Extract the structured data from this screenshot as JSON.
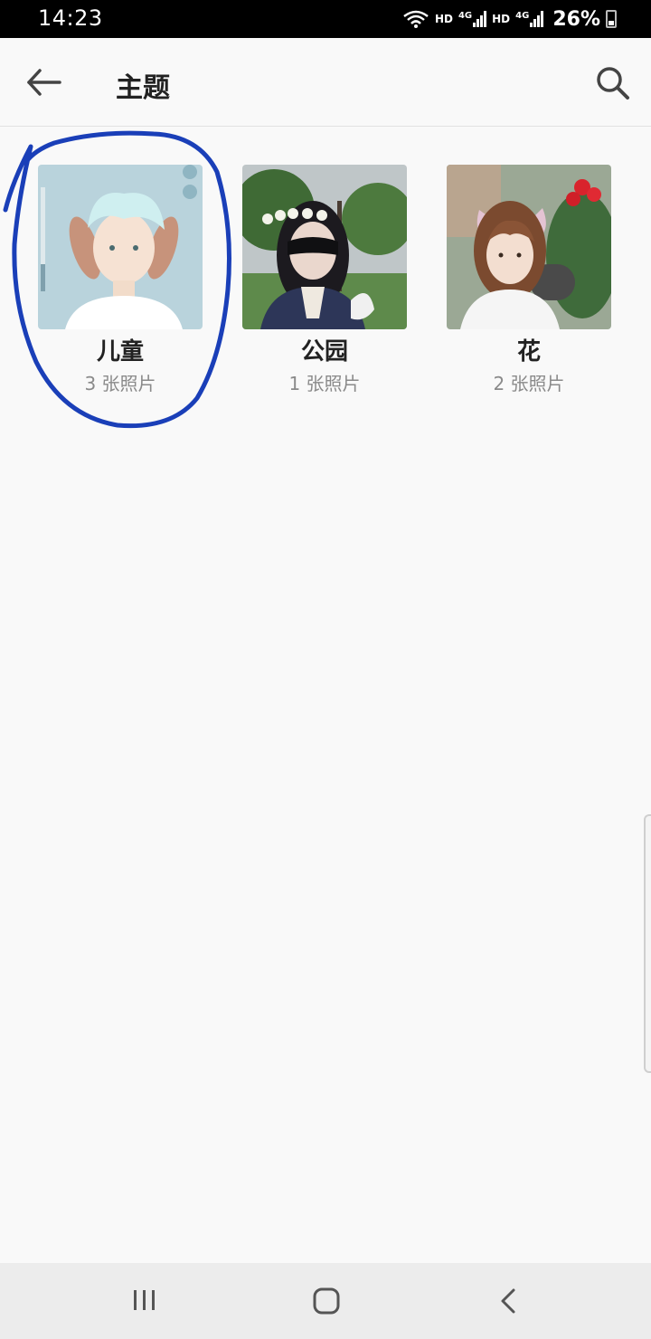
{
  "status_bar": {
    "time": "14:23",
    "network_1": "HD",
    "network_2": "HD",
    "signal_label": "4G",
    "battery": "26%"
  },
  "app_bar": {
    "title": "主题",
    "back_icon": "arrow-left-icon",
    "search_icon": "search-icon"
  },
  "albums": [
    {
      "name": "儿童",
      "count": "3 张照片",
      "highlighted": true
    },
    {
      "name": "公园",
      "count": "1 张照片",
      "highlighted": false
    },
    {
      "name": "花",
      "count": "2 张照片",
      "highlighted": false
    }
  ],
  "nav_bar": {
    "recents_icon": "recents-icon",
    "home_icon": "home-icon",
    "back_icon": "back-chevron-icon"
  },
  "colors": {
    "background": "#f9f9f9",
    "annotation": "#1a3fb8",
    "nav_bar": "#ececec"
  }
}
